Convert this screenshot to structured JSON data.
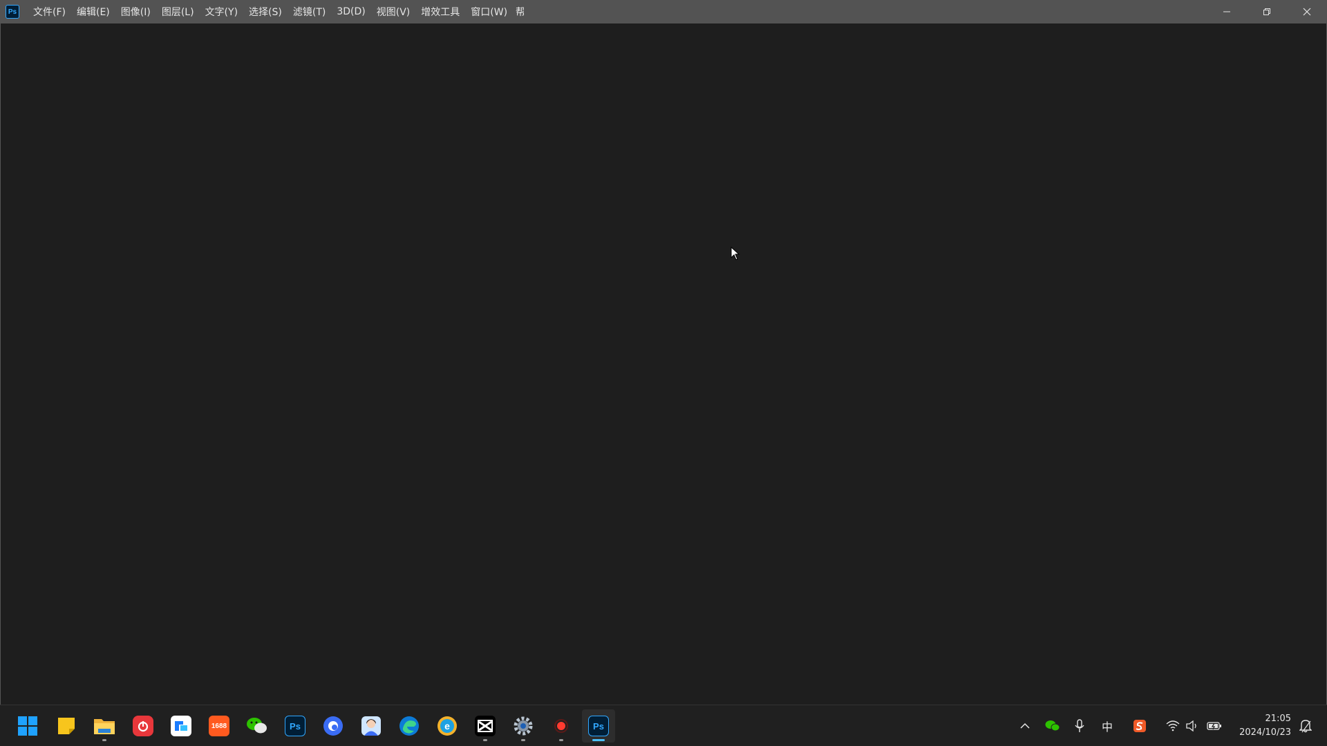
{
  "app": {
    "logo_text": "Ps",
    "menu": [
      {
        "label": "文件(F)"
      },
      {
        "label": "编辑(E)"
      },
      {
        "label": "图像(I)"
      },
      {
        "label": "图层(L)"
      },
      {
        "label": "文字(Y)"
      },
      {
        "label": "选择(S)"
      },
      {
        "label": "滤镜(T)"
      },
      {
        "label": "3D(D)"
      },
      {
        "label": "视图(V)"
      },
      {
        "label": "增效工具"
      },
      {
        "label": "窗口(W)"
      },
      {
        "label": "帮"
      }
    ]
  },
  "taskbar": {
    "apps": [
      {
        "name": "windows-start-icon"
      },
      {
        "name": "sticky-notes-icon"
      },
      {
        "name": "file-explorer-icon"
      },
      {
        "name": "netease-music-icon"
      },
      {
        "name": "tencent-meeting-icon"
      },
      {
        "name": "1688-icon",
        "label": "1688"
      },
      {
        "name": "wechat-icon"
      },
      {
        "name": "photoshop-icon",
        "label": "Ps"
      },
      {
        "name": "quark-browser-icon"
      },
      {
        "name": "avatar-app-icon"
      },
      {
        "name": "edge-icon"
      },
      {
        "name": "ie-browser-icon"
      },
      {
        "name": "capcut-icon"
      },
      {
        "name": "settings-gear-icon"
      },
      {
        "name": "screen-recorder-icon"
      },
      {
        "name": "photoshop-active-icon",
        "label": "Ps"
      }
    ],
    "tray": {
      "ime_label": "中",
      "time": "21:05",
      "date": "2024/10/23"
    }
  },
  "colors": {
    "menubar": "#535353",
    "workspace": "#1e1e1e",
    "taskbar": "#202020",
    "accent": "#4cc2ff",
    "ps_blue": "#31a8ff"
  }
}
